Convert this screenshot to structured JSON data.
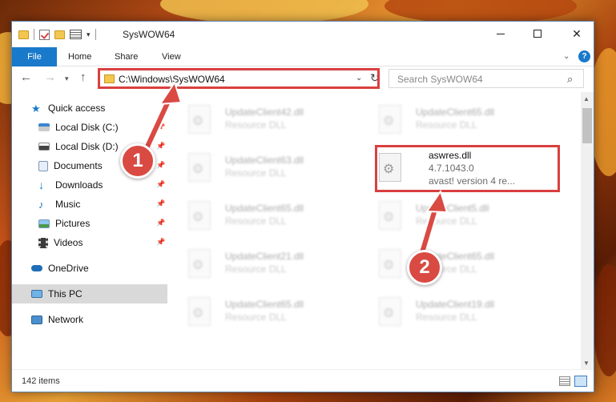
{
  "window": {
    "title": "SysWOW64",
    "minimize_label": "",
    "maximize_label": "",
    "close_label": "✕"
  },
  "ribbon": {
    "tabs": [
      {
        "label": "File"
      },
      {
        "label": "Home"
      },
      {
        "label": "Share"
      },
      {
        "label": "View"
      }
    ],
    "help_label": "?"
  },
  "address_bar": {
    "path": "C:\\Windows\\SysWOW64",
    "search_placeholder": "Search SysWOW64"
  },
  "sidebar": {
    "items": [
      {
        "label": "Quick access"
      },
      {
        "label": "Local Disk (C:)"
      },
      {
        "label": "Local Disk (D:)"
      },
      {
        "label": "Documents"
      },
      {
        "label": "Downloads"
      },
      {
        "label": "Music"
      },
      {
        "label": "Pictures"
      },
      {
        "label": "Videos"
      },
      {
        "label": "OneDrive"
      },
      {
        "label": "This PC"
      },
      {
        "label": "Network"
      }
    ]
  },
  "files": [
    {
      "name": "UpdateClient42.dll",
      "sub": "Resource DLL"
    },
    {
      "name": "UpdateClient65.dll",
      "sub": "Resource DLL"
    },
    {
      "name": "UpdateClient63.dll",
      "sub": "Resource DLL"
    },
    {
      "name": "aswres.dll",
      "sub": "4.7.1043.0",
      "sub2": "avast! version 4 re..."
    },
    {
      "name": "UpdateClient65.dll",
      "sub": "Resource DLL"
    },
    {
      "name": "UpdateClient5.dll",
      "sub": "Resource DLL"
    },
    {
      "name": "UpdateClient21.dll",
      "sub": "Resource DLL"
    },
    {
      "name": "UpdateClient65.dll",
      "sub": "Resource DLL"
    },
    {
      "name": "UpdateClient65.dll",
      "sub": "Resource DLL"
    },
    {
      "name": "UpdateClient19.dll",
      "sub": "Resource DLL"
    }
  ],
  "status": {
    "item_count": "142 items"
  },
  "callouts": {
    "one": "1",
    "two": "2"
  },
  "colors": {
    "accent": "#1979ca",
    "highlight": "#d9403f",
    "callout": "#d94a43"
  }
}
